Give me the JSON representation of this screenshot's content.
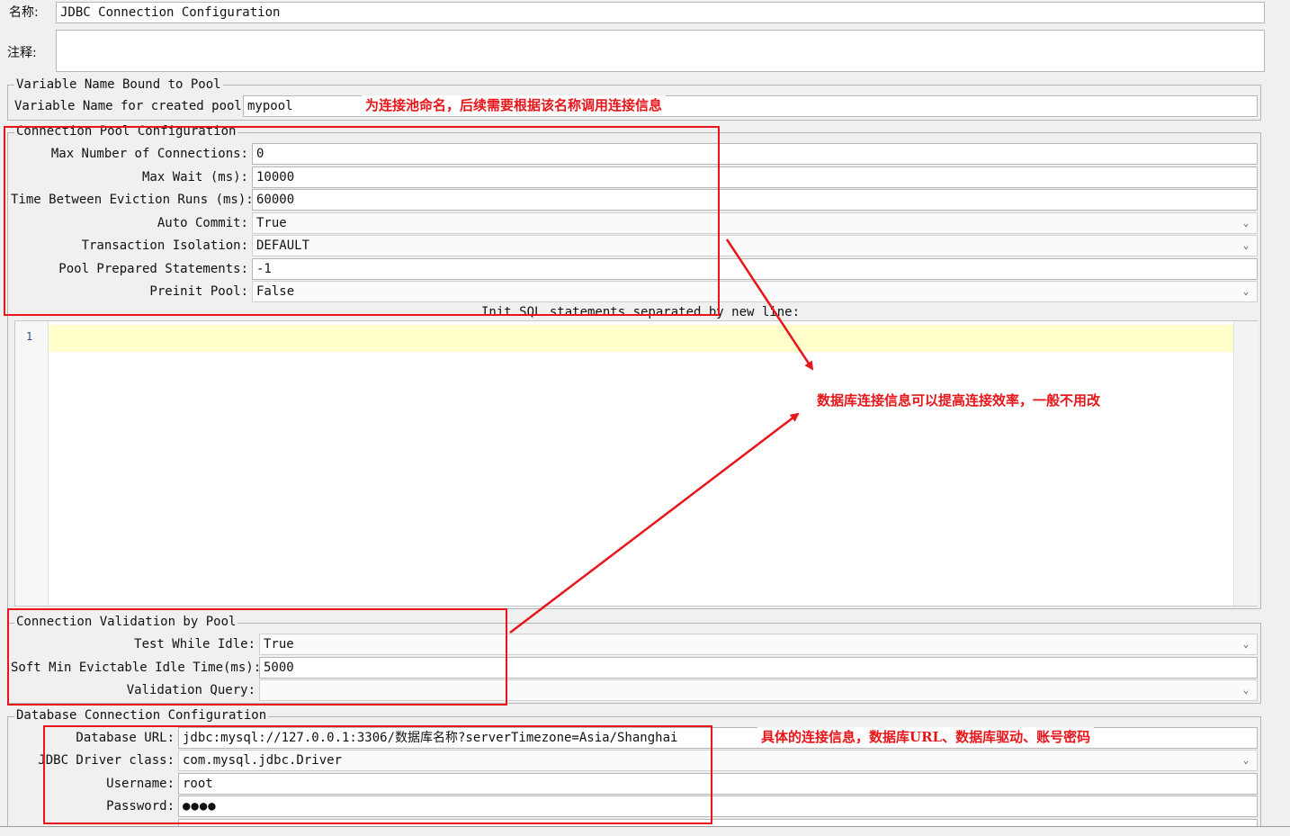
{
  "header": {
    "name_label": "名称:",
    "name_value": "JDBC Connection Configuration",
    "comment_label": "注释:"
  },
  "variable_group": {
    "title": "Variable Name Bound to Pool",
    "pool_label": "Variable Name for created pool:",
    "pool_value": "mypool"
  },
  "pool_group": {
    "title": "Connection Pool Configuration",
    "max_connections_label": "Max Number of Connections:",
    "max_connections_value": "0",
    "max_wait_label": "Max Wait (ms):",
    "max_wait_value": "10000",
    "eviction_label": "Time Between Eviction Runs (ms):",
    "eviction_value": "60000",
    "auto_commit_label": "Auto Commit:",
    "auto_commit_value": "True",
    "isolation_label": "Transaction Isolation:",
    "isolation_value": "DEFAULT",
    "prepared_label": "Pool Prepared Statements:",
    "prepared_value": "-1",
    "preinit_label": "Preinit Pool:",
    "preinit_value": "False",
    "init_sql_label": "Init SQL statements separated by new line:",
    "line_number": "1"
  },
  "validation_group": {
    "title": "Connection Validation by Pool",
    "test_idle_label": "Test While Idle:",
    "test_idle_value": "True",
    "soft_min_label": "Soft Min Evictable Idle Time(ms):",
    "soft_min_value": "5000",
    "query_label": "Validation Query:",
    "query_value": ""
  },
  "db_group": {
    "title": "Database Connection Configuration",
    "url_label": "Database URL:",
    "url_value": "jdbc:mysql://127.0.0.1:3306/数据库名称?serverTimezone=Asia/Shanghai",
    "driver_label": "JDBC Driver class:",
    "driver_value": "com.mysql.jdbc.Driver",
    "username_label": "Username:",
    "username_value": "root",
    "password_label": "Password:",
    "password_value": "●●●●"
  },
  "annotations": {
    "pool_name_note": "为连接池命名，后续需要根据该名称调用连接信息",
    "pool_config_note": "数据库连接信息可以提高连接效率，一般不用改",
    "db_note": "具体的连接信息，数据库URL、数据库驱动、账号密码"
  },
  "colors": {
    "annotation_red": "#e8161a",
    "editor_highlight": "#ffffcc"
  }
}
